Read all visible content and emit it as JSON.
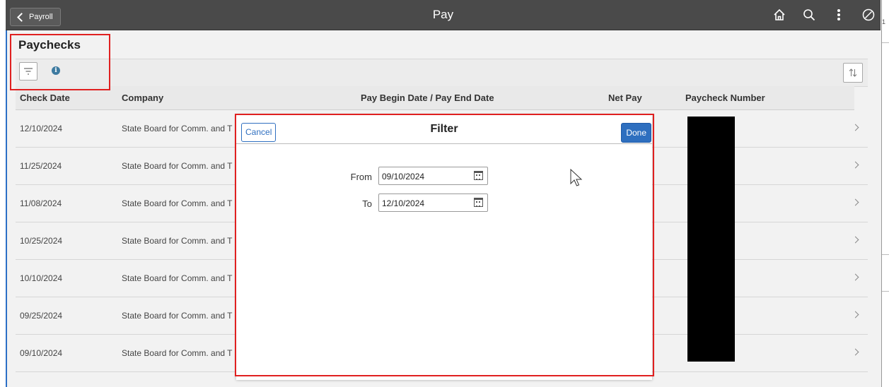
{
  "header": {
    "back_label": "Payroll",
    "title": "Pay"
  },
  "page": {
    "title": "Paychecks"
  },
  "grid": {
    "columns": [
      "Check Date",
      "Company",
      "Pay Begin Date / Pay End Date",
      "Net Pay",
      "Paycheck Number"
    ],
    "rows": [
      {
        "check_date": "12/10/2024",
        "company": "State Board for Comm. and T"
      },
      {
        "check_date": "11/25/2024",
        "company": "State Board for Comm. and T"
      },
      {
        "check_date": "11/08/2024",
        "company": "State Board for Comm. and T"
      },
      {
        "check_date": "10/25/2024",
        "company": "State Board for Comm. and T"
      },
      {
        "check_date": "10/10/2024",
        "company": "State Board for Comm. and T"
      },
      {
        "check_date": "09/25/2024",
        "company": "State Board for Comm. and T"
      },
      {
        "check_date": "09/10/2024",
        "company": "State Board for Comm. and T"
      }
    ]
  },
  "filter_modal": {
    "title": "Filter",
    "cancel_label": "Cancel",
    "done_label": "Done",
    "from_label": "From",
    "from_value": "09/10/2024",
    "to_label": "To",
    "to_value": "12/10/2024"
  },
  "edge": {
    "mark": "1"
  },
  "colors": {
    "topbar": "#4a4a4a",
    "accent": "#2e6fbf",
    "highlight": "#e02020"
  }
}
